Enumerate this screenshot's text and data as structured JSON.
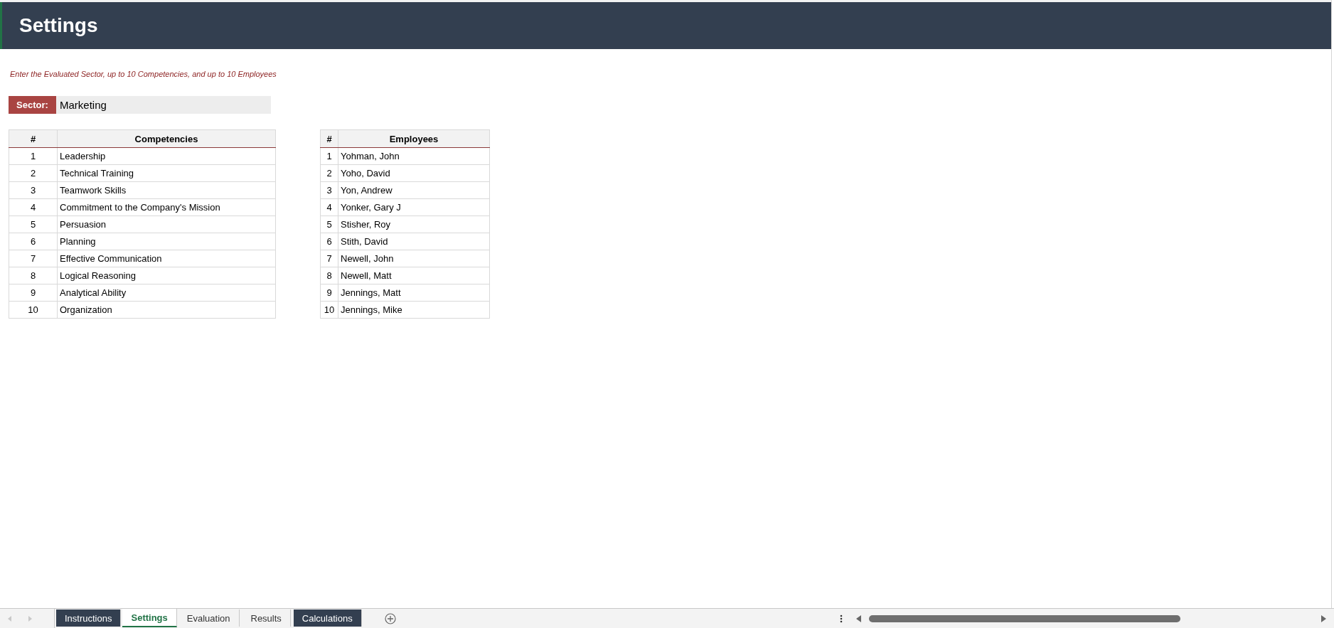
{
  "header": {
    "title": "Settings"
  },
  "instruction": "Enter the Evaluated Sector, up to 10 Competencies, and up to 10 Employees",
  "sector": {
    "label": "Sector:",
    "value": "Marketing"
  },
  "competencies": {
    "columns": [
      "#",
      "Competencies"
    ],
    "rows": [
      [
        "1",
        "Leadership"
      ],
      [
        "2",
        "Technical Training"
      ],
      [
        "3",
        "Teamwork Skills"
      ],
      [
        "4",
        "Commitment to the Company's Mission"
      ],
      [
        "5",
        "Persuasion"
      ],
      [
        "6",
        "Planning"
      ],
      [
        "7",
        "Effective Communication"
      ],
      [
        "8",
        "Logical Reasoning"
      ],
      [
        "9",
        "Analytical Ability"
      ],
      [
        "10",
        "Organization"
      ]
    ]
  },
  "employees": {
    "columns": [
      "#",
      "Employees"
    ],
    "rows": [
      [
        "1",
        "Yohman, John"
      ],
      [
        "2",
        "Yoho, David"
      ],
      [
        "3",
        "Yon, Andrew"
      ],
      [
        "4",
        "Yonker, Gary J"
      ],
      [
        "5",
        "Stisher, Roy"
      ],
      [
        "6",
        "Stith, David"
      ],
      [
        "7",
        "Newell, John"
      ],
      [
        "8",
        "Newell, Matt"
      ],
      [
        "9",
        "Jennings, Matt"
      ],
      [
        "10",
        "Jennings, Mike"
      ]
    ]
  },
  "sheet_tabs": [
    {
      "label": "Instructions",
      "selected": false,
      "color": "#333f50"
    },
    {
      "label": "Settings",
      "selected": true
    },
    {
      "label": "Evaluation",
      "selected": false
    },
    {
      "label": "Results",
      "selected": false
    },
    {
      "label": "Calculations",
      "selected": false,
      "color": "#333f50"
    }
  ]
}
